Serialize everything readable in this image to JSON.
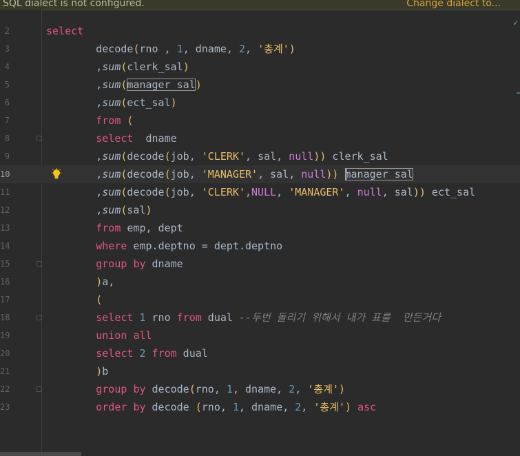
{
  "banner": {
    "message": "SQL dialect is not configured.",
    "action": "Change dialect to..."
  },
  "editor": {
    "current_line": 10,
    "lines": [
      {
        "n": 2,
        "tokens": [
          [
            "kwp",
            "select"
          ]
        ]
      },
      {
        "n": 3,
        "tokens": [
          [
            "ws",
            "        "
          ],
          [
            "fn",
            "decode"
          ],
          [
            "par",
            "("
          ],
          [
            "fn",
            "rno "
          ],
          [
            "punc",
            ", "
          ],
          [
            "num",
            "1"
          ],
          [
            "punc",
            ", "
          ],
          [
            "fn",
            "dname"
          ],
          [
            "punc",
            ", "
          ],
          [
            "num",
            "2"
          ],
          [
            "punc",
            ", "
          ],
          [
            "str",
            "'총계'"
          ],
          [
            "par",
            ")"
          ]
        ]
      },
      {
        "n": 4,
        "tokens": [
          [
            "ws",
            "        "
          ],
          [
            "punc",
            ","
          ],
          [
            "fni",
            "sum"
          ],
          [
            "par",
            "("
          ],
          [
            "fn",
            "clerk_sal"
          ],
          [
            "par",
            ")"
          ]
        ]
      },
      {
        "n": 5,
        "tokens": [
          [
            "ws",
            "        "
          ],
          [
            "punc",
            ","
          ],
          [
            "fni",
            "sum"
          ],
          [
            "par",
            "("
          ],
          [
            "box",
            "manager_sal"
          ],
          [
            "par",
            ")"
          ]
        ]
      },
      {
        "n": 6,
        "tokens": [
          [
            "ws",
            "        "
          ],
          [
            "punc",
            ","
          ],
          [
            "fni",
            "sum"
          ],
          [
            "par",
            "("
          ],
          [
            "fn",
            "ect_sal"
          ],
          [
            "par",
            ")"
          ]
        ]
      },
      {
        "n": 7,
        "tokens": [
          [
            "ws",
            "        "
          ],
          [
            "kwp",
            "from"
          ],
          [
            "ws",
            " "
          ],
          [
            "par",
            "("
          ]
        ]
      },
      {
        "n": 8,
        "tokens": [
          [
            "ws",
            "        "
          ],
          [
            "kwp",
            "select"
          ],
          [
            "ws",
            "  "
          ],
          [
            "fn",
            "dname"
          ]
        ]
      },
      {
        "n": 9,
        "tokens": [
          [
            "ws",
            "        "
          ],
          [
            "punc",
            ","
          ],
          [
            "fni",
            "sum"
          ],
          [
            "par",
            "("
          ],
          [
            "fn",
            "decode"
          ],
          [
            "par",
            "("
          ],
          [
            "fn",
            "job"
          ],
          [
            "punc",
            ", "
          ],
          [
            "str",
            "'CLERK'"
          ],
          [
            "punc",
            ", "
          ],
          [
            "fn",
            "sal"
          ],
          [
            "punc",
            ", "
          ],
          [
            "nul",
            "null"
          ],
          [
            "par",
            "))"
          ],
          [
            "fn",
            " clerk_sal"
          ]
        ]
      },
      {
        "n": 10,
        "tokens": [
          [
            "ws",
            "        "
          ],
          [
            "punc",
            ","
          ],
          [
            "fni",
            "sum"
          ],
          [
            "par",
            "("
          ],
          [
            "fn",
            "decode"
          ],
          [
            "par",
            "("
          ],
          [
            "fn",
            "job"
          ],
          [
            "punc",
            ", "
          ],
          [
            "str",
            "'MANAGER'"
          ],
          [
            "punc",
            ", "
          ],
          [
            "fn",
            "sal"
          ],
          [
            "punc",
            ", "
          ],
          [
            "nul",
            "null"
          ],
          [
            "par",
            "))"
          ],
          [
            "ws",
            " "
          ],
          [
            "caretbox",
            "manager_sal"
          ]
        ]
      },
      {
        "n": 11,
        "tokens": [
          [
            "ws",
            "        "
          ],
          [
            "punc",
            ","
          ],
          [
            "fni",
            "sum"
          ],
          [
            "par",
            "("
          ],
          [
            "fn",
            "decode"
          ],
          [
            "par",
            "("
          ],
          [
            "fn",
            "job"
          ],
          [
            "punc",
            ", "
          ],
          [
            "str",
            "'CLERK'"
          ],
          [
            "punc",
            ","
          ],
          [
            "nul",
            "NULL"
          ],
          [
            "punc",
            ", "
          ],
          [
            "str",
            "'MANAGER'"
          ],
          [
            "punc",
            ", "
          ],
          [
            "nul",
            "null"
          ],
          [
            "punc",
            ", "
          ],
          [
            "fn",
            "sal"
          ],
          [
            "par",
            "))"
          ],
          [
            "fn",
            " ect_sal"
          ]
        ]
      },
      {
        "n": 12,
        "tokens": [
          [
            "ws",
            "        "
          ],
          [
            "punc",
            ","
          ],
          [
            "fni",
            "sum"
          ],
          [
            "par",
            "("
          ],
          [
            "fn",
            "sal"
          ],
          [
            "par",
            ")"
          ]
        ]
      },
      {
        "n": 13,
        "tokens": [
          [
            "ws",
            "        "
          ],
          [
            "kwp",
            "from"
          ],
          [
            "fn",
            " emp"
          ],
          [
            "punc",
            ", "
          ],
          [
            "fn",
            "dept"
          ]
        ]
      },
      {
        "n": 14,
        "tokens": [
          [
            "ws",
            "        "
          ],
          [
            "kwp",
            "where"
          ],
          [
            "fn",
            " emp"
          ],
          [
            "punc",
            "."
          ],
          [
            "fn",
            "deptno"
          ],
          [
            "punc",
            " = "
          ],
          [
            "fn",
            "dept"
          ],
          [
            "punc",
            "."
          ],
          [
            "fn",
            "deptno"
          ]
        ]
      },
      {
        "n": 15,
        "tokens": [
          [
            "ws",
            "        "
          ],
          [
            "kwp",
            "group"
          ],
          [
            "ws",
            " "
          ],
          [
            "kwp",
            "by"
          ],
          [
            "fn",
            " dname"
          ]
        ]
      },
      {
        "n": 16,
        "tokens": [
          [
            "ws",
            "        "
          ],
          [
            "par",
            ")"
          ],
          [
            "fn",
            "a"
          ],
          [
            "punc",
            ","
          ]
        ]
      },
      {
        "n": 17,
        "tokens": [
          [
            "ws",
            "        "
          ],
          [
            "par",
            "("
          ]
        ]
      },
      {
        "n": 18,
        "tokens": [
          [
            "ws",
            "        "
          ],
          [
            "kwp",
            "select"
          ],
          [
            "ws",
            " "
          ],
          [
            "num",
            "1"
          ],
          [
            "fn",
            " rno "
          ],
          [
            "kwp",
            "from"
          ],
          [
            "fn",
            " dual "
          ],
          [
            "com",
            "--두번 돌리기 위해서 내가 표를  만든거다"
          ]
        ]
      },
      {
        "n": 19,
        "tokens": [
          [
            "ws",
            "        "
          ],
          [
            "kwp",
            "union"
          ],
          [
            "ws",
            " "
          ],
          [
            "kwp",
            "all"
          ]
        ]
      },
      {
        "n": 20,
        "tokens": [
          [
            "ws",
            "        "
          ],
          [
            "kwp",
            "select"
          ],
          [
            "ws",
            " "
          ],
          [
            "num",
            "2"
          ],
          [
            "ws",
            " "
          ],
          [
            "kwp",
            "from"
          ],
          [
            "fn",
            " dual"
          ]
        ]
      },
      {
        "n": 21,
        "tokens": [
          [
            "ws",
            "        "
          ],
          [
            "par",
            ")"
          ],
          [
            "fn",
            "b"
          ]
        ]
      },
      {
        "n": 22,
        "tokens": [
          [
            "ws",
            "        "
          ],
          [
            "kwp",
            "group"
          ],
          [
            "ws",
            " "
          ],
          [
            "kwp",
            "by"
          ],
          [
            "ws",
            " "
          ],
          [
            "fn",
            "decode"
          ],
          [
            "par",
            "("
          ],
          [
            "fn",
            "rno"
          ],
          [
            "punc",
            ", "
          ],
          [
            "num",
            "1"
          ],
          [
            "punc",
            ", "
          ],
          [
            "fn",
            "dname"
          ],
          [
            "punc",
            ", "
          ],
          [
            "num",
            "2"
          ],
          [
            "punc",
            ", "
          ],
          [
            "str",
            "'총계'"
          ],
          [
            "par",
            ")"
          ]
        ]
      },
      {
        "n": 23,
        "tokens": [
          [
            "ws",
            "        "
          ],
          [
            "kwp",
            "order"
          ],
          [
            "ws",
            " "
          ],
          [
            "kwp",
            "by"
          ],
          [
            "fn",
            " decode "
          ],
          [
            "par",
            "("
          ],
          [
            "fn",
            "rno"
          ],
          [
            "punc",
            ", "
          ],
          [
            "num",
            "1"
          ],
          [
            "punc",
            ", "
          ],
          [
            "fn",
            "dname"
          ],
          [
            "punc",
            ", "
          ],
          [
            "num",
            "2"
          ],
          [
            "punc",
            ", "
          ],
          [
            "str",
            "'총계'"
          ],
          [
            "par",
            ")"
          ],
          [
            "ws",
            " "
          ],
          [
            "kwp",
            "asc"
          ]
        ]
      }
    ]
  },
  "icons": {
    "bulb": "lightbulb-icon",
    "check": "check-icon"
  },
  "colors": {
    "background": "#2b2b2b",
    "keyword": "#e0567e",
    "string": "#e8bf6a",
    "number": "#6897bb",
    "null": "#cc7ad6",
    "comment": "#808080",
    "banner_action": "#d9a33c"
  }
}
